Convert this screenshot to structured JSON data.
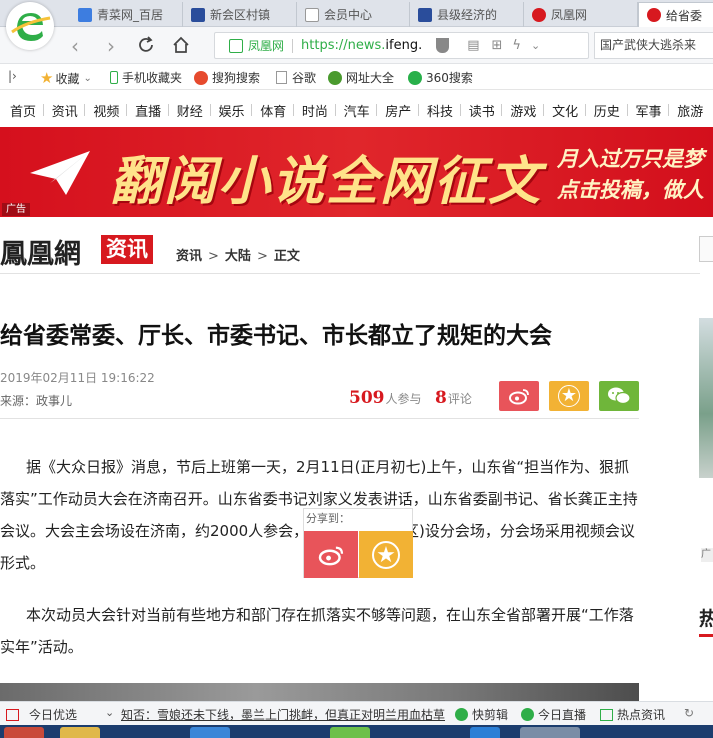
{
  "tabs": [
    {
      "label": "青菜网_百居",
      "color": "#3d7de0"
    },
    {
      "label": "新会区村镇",
      "color": "#2a4d9b"
    },
    {
      "label": "会员中心",
      "color": "#999999"
    },
    {
      "label": "县级经济的",
      "color": "#2a4d9b"
    },
    {
      "label": "凤凰网",
      "color": "#d7191f"
    },
    {
      "label": "给省委",
      "color": "#d7191f"
    }
  ],
  "address": {
    "site_name": "凤凰网",
    "url_prefix": "https://news.",
    "url_domain": "ifeng.",
    "search_text": "国产武侠大逃杀来"
  },
  "bookmarks": [
    {
      "label": "收藏",
      "icon": "star-icon"
    },
    {
      "label": "手机收藏夹",
      "icon": "phone-icon"
    },
    {
      "label": "搜狗搜索",
      "icon": "sogou-icon"
    },
    {
      "label": "谷歌",
      "icon": "page-icon"
    },
    {
      "label": "网址大全",
      "icon": "sites-icon"
    },
    {
      "label": "360搜索",
      "icon": "360-icon"
    }
  ],
  "site_nav": [
    "首页",
    "资讯",
    "视频",
    "直播",
    "财经",
    "娱乐",
    "体育",
    "时尚",
    "汽车",
    "房产",
    "科技",
    "读书",
    "游戏",
    "文化",
    "历史",
    "军事",
    "旅游"
  ],
  "banner": {
    "title": "翻阅小说全网征文",
    "sub1": "月入过万只是梦",
    "sub2": "点击投稿，做人",
    "ad_tag": "广告"
  },
  "channel": {
    "logo": "鳳凰網",
    "tag": "资讯",
    "crumbs": [
      "资讯",
      "大陆",
      "正文"
    ],
    "crumb_sep": ">"
  },
  "article": {
    "title": "给省委常委、厅长、市委书记、市长都立了规矩的大会",
    "date": "2019年02月11日 19:16:22",
    "source": "来源：政事儿",
    "participants": "509",
    "participants_label": "人参与",
    "comments": "8",
    "comments_label": "评论",
    "paragraphs": [
      "据《大众日报》消息，节后上班第一天，2月11日(正月初七)上午，山东省“担当作为、狠抓落实”工作动员大会在济南召开。山东省委书记刘家义发表讲话，山东省委副书记、省长龚正主持会议。大会主会场设在济南，约2000人参会，各市、县(市、区)设分会场，分会场采用视频会议形式。",
      "本次动员大会针对当前有些地方和部门存在抓落实不够等问题，在山东全省部署开展“工作落实年”活动。"
    ]
  },
  "share_popup": {
    "label": "分享到："
  },
  "right_rail": {
    "ad_tag": "广",
    "hot": "热"
  },
  "statusbar": {
    "today": "今日优选",
    "news": "知否：雪娘还未下线，墨兰上门挑衅，但真正对明兰用血枯草",
    "fast": "快剪辑",
    "live": "今日直播",
    "hot": "热点资讯"
  },
  "colors": {
    "brand_red": "#d7191f",
    "weibo_red": "#e8545a",
    "fav_yellow": "#f2b234",
    "wechat_green": "#6fb63a"
  }
}
